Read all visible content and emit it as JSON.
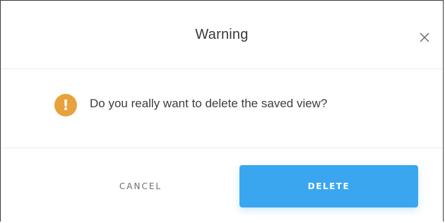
{
  "dialog": {
    "title": "Warning",
    "close_icon": "close-icon",
    "message": "Do you really want to delete the saved view?",
    "warning_icon": "exclamation-icon",
    "warning_glyph": "!",
    "cancel_label": "CANCEL",
    "delete_label": "DELETE"
  },
  "colors": {
    "accent": "#3aa6ef",
    "warning": "#e8a23c",
    "text": "#3d3d3d"
  }
}
